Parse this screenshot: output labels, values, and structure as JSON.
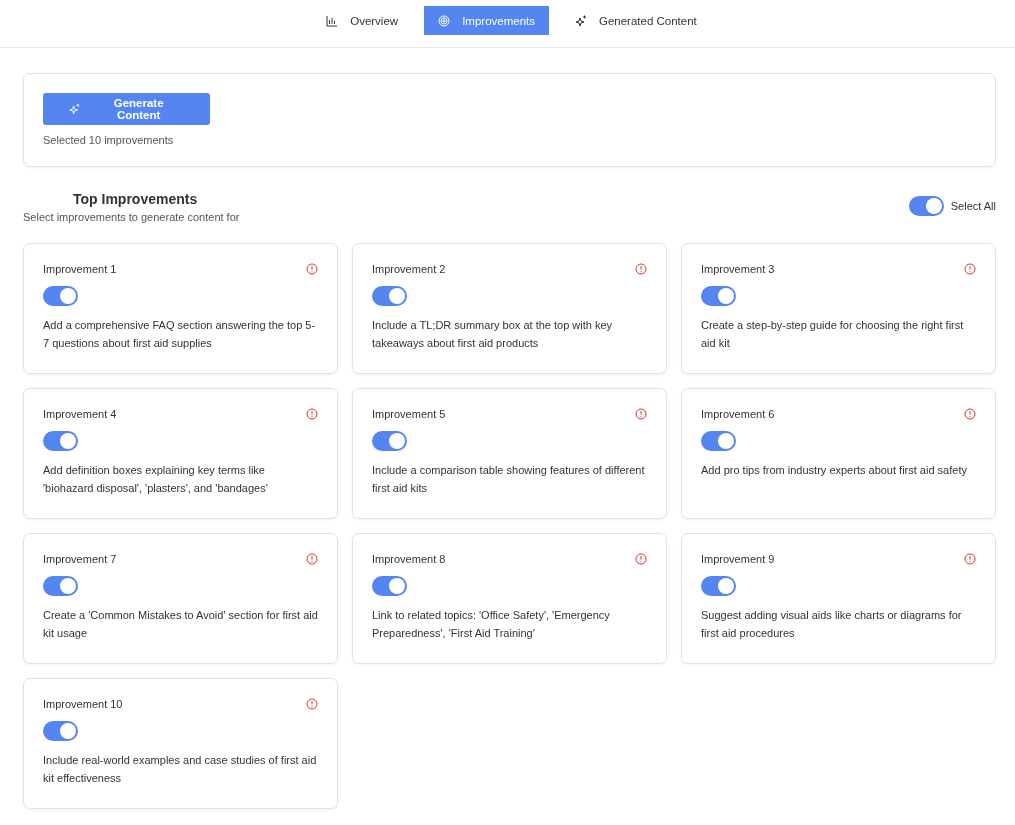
{
  "tabs": [
    {
      "label": "Overview",
      "selected": false
    },
    {
      "label": "Improvements",
      "selected": true
    },
    {
      "label": "Generated Content",
      "selected": false
    }
  ],
  "generate": {
    "button": "Generate Content",
    "status": "Selected 10 improvements"
  },
  "section": {
    "title": "Top Improvements",
    "subtitle": "Select improvements to generate content for",
    "select_all": {
      "label": "Select All",
      "on": true
    }
  },
  "improvements": [
    {
      "title": "Improvement 1",
      "on": true,
      "text": "Add a comprehensive FAQ section answering the top 5-7 questions about first aid supplies"
    },
    {
      "title": "Improvement 2",
      "on": true,
      "text": "Include a TL;DR summary box at the top with key takeaways about first aid products"
    },
    {
      "title": "Improvement 3",
      "on": true,
      "text": "Create a step-by-step guide for choosing the right first aid kit"
    },
    {
      "title": "Improvement 4",
      "on": true,
      "text": "Add definition boxes explaining key terms like 'biohazard disposal', 'plasters', and 'bandages'"
    },
    {
      "title": "Improvement 5",
      "on": true,
      "text": "Include a comparison table showing features of different first aid kits"
    },
    {
      "title": "Improvement 6",
      "on": true,
      "text": "Add pro tips from industry experts about first aid safety"
    },
    {
      "title": "Improvement 7",
      "on": true,
      "text": "Create a 'Common Mistakes to Avoid' section for first aid kit usage"
    },
    {
      "title": "Improvement 8",
      "on": true,
      "text": "Link to related topics: 'Office Safety', 'Emergency Preparedness', 'First Aid Training'"
    },
    {
      "title": "Improvement 9",
      "on": true,
      "text": "Suggest adding visual aids like charts or diagrams for first aid procedures"
    },
    {
      "title": "Improvement 10",
      "on": true,
      "text": "Include real-world examples and case studies of first aid kit effectiveness"
    }
  ]
}
